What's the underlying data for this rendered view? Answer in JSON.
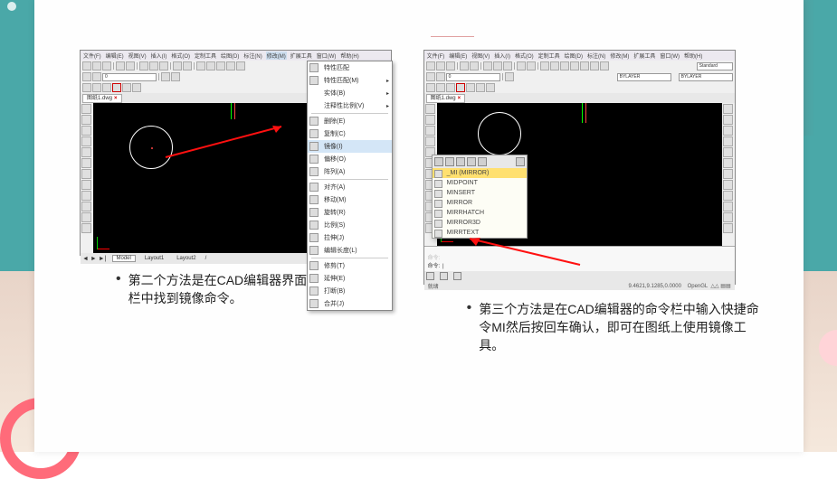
{
  "menu": {
    "items": [
      "文件(F)",
      "编辑(E)",
      "视图(V)",
      "插入(I)",
      "格式(O)",
      "定制工具",
      "绘图(D)",
      "标注(N)",
      "修改(M)",
      "扩展工具",
      "窗口(W)",
      "帮助(H)"
    ]
  },
  "toolbar": {
    "bylayer": "BYLAYER",
    "standard": "Standard"
  },
  "filetab": {
    "name": "图纸1.dwg"
  },
  "dropdown1": {
    "items": [
      {
        "label": "特性匹配",
        "icon": true
      },
      {
        "label": "特性匹配(M)",
        "icon": true,
        "arrow": true
      },
      {
        "label": "实体(B)",
        "arrow": true
      },
      {
        "label": "注释性比例(V)",
        "arrow": true
      },
      {
        "sep": true
      },
      {
        "label": "删除(E)",
        "icon": true
      },
      {
        "label": "复制(C)",
        "icon": true
      },
      {
        "label": "镜像(I)",
        "icon": true,
        "hi": true
      },
      {
        "label": "偏移(O)",
        "icon": true
      },
      {
        "label": "阵列(A)",
        "icon": true
      },
      {
        "sep": true
      },
      {
        "label": "对齐(A)",
        "icon": true
      },
      {
        "label": "移动(M)",
        "icon": true
      },
      {
        "label": "旋转(R)",
        "icon": true
      },
      {
        "label": "比例(S)",
        "icon": true
      },
      {
        "label": "拉伸(J)",
        "icon": true
      },
      {
        "label": "编辑长度(L)",
        "icon": true
      },
      {
        "sep": true
      },
      {
        "label": "修剪(T)",
        "icon": true
      },
      {
        "label": "延伸(E)",
        "icon": true
      },
      {
        "label": "打断(B)",
        "icon": true
      },
      {
        "label": "合并(J)",
        "icon": true
      }
    ]
  },
  "autocomplete": {
    "input": "_MI (MIRROR)",
    "items": [
      "MIDPOINT",
      "MINSERT",
      "MIRROR",
      "MIRRHATCH",
      "MIRROR3D",
      "MIRRTEXT"
    ]
  },
  "bottom": {
    "tabs": [
      "Model",
      "Layout1",
      "Layout2"
    ],
    "coords": "9.4621,9.1285,0.0000",
    "render": "OpenGL"
  },
  "captions": {
    "left": "第二个方法是在CAD编辑器界面的上方修改栏中找到镜像命令。",
    "right": "第三个方法是在CAD编辑器的命令栏中输入快捷命令MI然后按回车确认，即可在图纸上使用镜像工具。"
  }
}
